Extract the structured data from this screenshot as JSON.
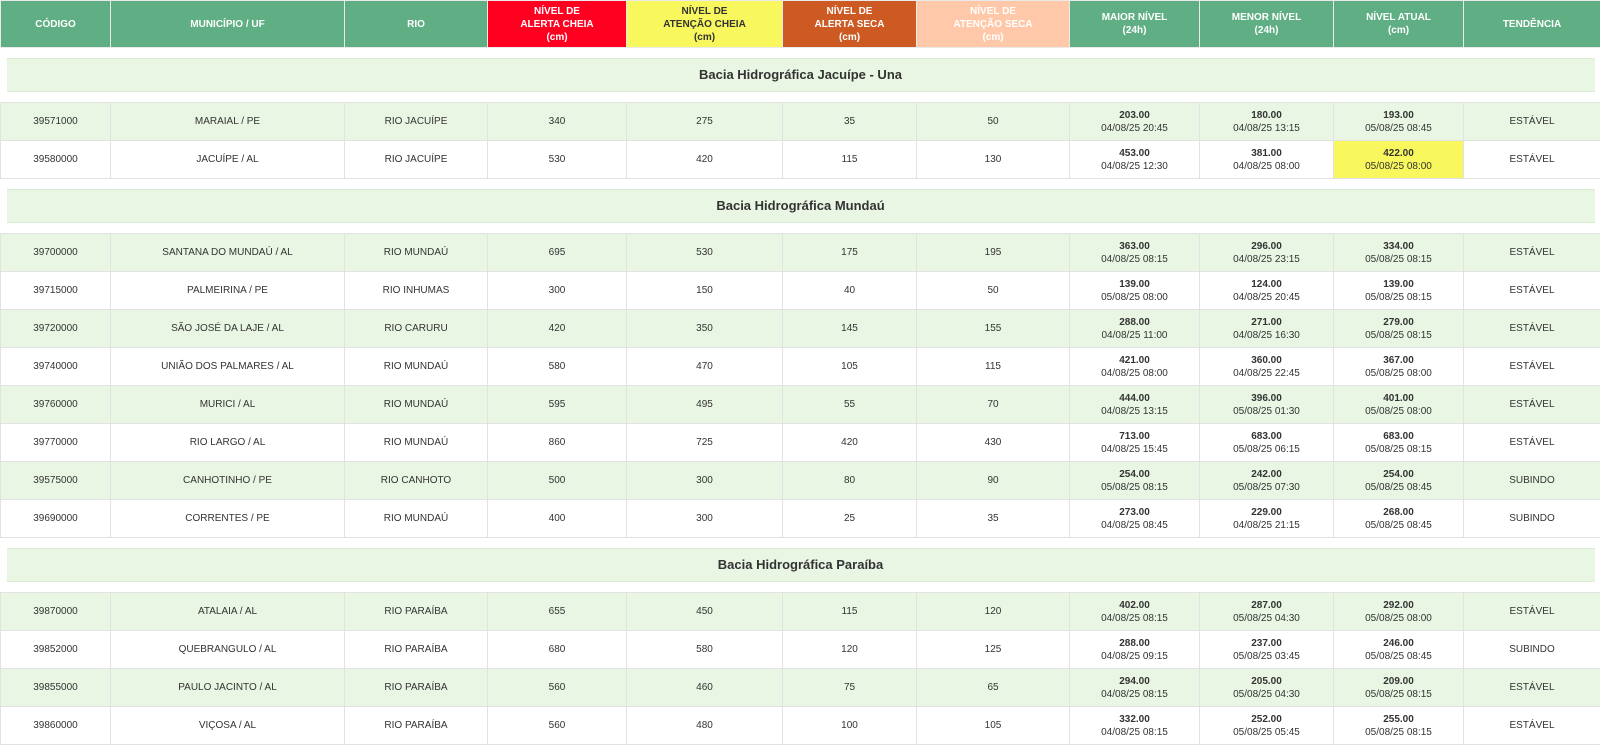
{
  "colors": {
    "header_green": "#5fae84",
    "alert_full": "#ff0020",
    "attention_full": "#f8f85e",
    "alert_dry": "#cc5a22",
    "attention_dry": "#ffc8a8",
    "row_alt": "#e8f6e3"
  },
  "headers": [
    {
      "l1": "CÓDIGO",
      "l2": "",
      "l3": ""
    },
    {
      "l1": "MUNICÍPIO / UF",
      "l2": "",
      "l3": ""
    },
    {
      "l1": "RIO",
      "l2": "",
      "l3": ""
    },
    {
      "l1": "NÍVEL DE",
      "l2": "ALERTA CHEIA",
      "l3": "(cm)"
    },
    {
      "l1": "NÍVEL DE",
      "l2": "ATENÇÃO CHEIA",
      "l3": "(cm)"
    },
    {
      "l1": "NÍVEL DE",
      "l2": "ALERTA SECA",
      "l3": "(cm)"
    },
    {
      "l1": "NÍVEL DE",
      "l2": "ATENÇÃO SECA",
      "l3": "(cm)"
    },
    {
      "l1": "MAIOR NÍVEL",
      "l2": "(24h)",
      "l3": ""
    },
    {
      "l1": "MENOR NÍVEL",
      "l2": "(24h)",
      "l3": ""
    },
    {
      "l1": "NÍVEL ATUAL",
      "l2": "(cm)",
      "l3": ""
    },
    {
      "l1": "TENDÊNCIA",
      "l2": "",
      "l3": ""
    }
  ],
  "groups": [
    {
      "title": "Bacia Hidrográfica Jacuípe - Una",
      "rows": [
        {
          "codigo": "39571000",
          "municipio": "MARAIAL / PE",
          "rio": "RIO JACUÍPE",
          "alerta_cheia": "340",
          "atencao_cheia": "275",
          "alerta_seca": "35",
          "atencao_seca": "50",
          "maior_v": "203.00",
          "maior_d": "04/08/25 20:45",
          "menor_v": "180.00",
          "menor_d": "04/08/25 13:15",
          "atual_v": "193.00",
          "atual_d": "05/08/25 08:45",
          "tendencia": "ESTÁVEL"
        },
        {
          "codigo": "39580000",
          "municipio": "JACUÍPE / AL",
          "rio": "RIO JACUÍPE",
          "alerta_cheia": "530",
          "atencao_cheia": "420",
          "alerta_seca": "115",
          "atencao_seca": "130",
          "maior_v": "453.00",
          "maior_d": "04/08/25 12:30",
          "menor_v": "381.00",
          "menor_d": "04/08/25 08:00",
          "atual_v": "422.00",
          "atual_d": "05/08/25 08:00",
          "tendencia": "ESTÁVEL"
        }
      ]
    },
    {
      "title": "Bacia Hidrográfica Mundaú",
      "rows": [
        {
          "codigo": "39700000",
          "municipio": "SANTANA DO MUNDAÚ / AL",
          "rio": "RIO MUNDAÚ",
          "alerta_cheia": "695",
          "atencao_cheia": "530",
          "alerta_seca": "175",
          "atencao_seca": "195",
          "maior_v": "363.00",
          "maior_d": "04/08/25 08:15",
          "menor_v": "296.00",
          "menor_d": "04/08/25 23:15",
          "atual_v": "334.00",
          "atual_d": "05/08/25 08:15",
          "tendencia": "ESTÁVEL"
        },
        {
          "codigo": "39715000",
          "municipio": "PALMEIRINA / PE",
          "rio": "RIO INHUMAS",
          "alerta_cheia": "300",
          "atencao_cheia": "150",
          "alerta_seca": "40",
          "atencao_seca": "50",
          "maior_v": "139.00",
          "maior_d": "05/08/25 08:00",
          "menor_v": "124.00",
          "menor_d": "04/08/25 20:45",
          "atual_v": "139.00",
          "atual_d": "05/08/25 08:15",
          "tendencia": "ESTÁVEL"
        },
        {
          "codigo": "39720000",
          "municipio": "SÃO JOSÉ DA LAJE / AL",
          "rio": "RIO CARURU",
          "alerta_cheia": "420",
          "atencao_cheia": "350",
          "alerta_seca": "145",
          "atencao_seca": "155",
          "maior_v": "288.00",
          "maior_d": "04/08/25 11:00",
          "menor_v": "271.00",
          "menor_d": "04/08/25 16:30",
          "atual_v": "279.00",
          "atual_d": "05/08/25 08:15",
          "tendencia": "ESTÁVEL"
        },
        {
          "codigo": "39740000",
          "municipio": "UNIÃO DOS PALMARES / AL",
          "rio": "RIO MUNDAÚ",
          "alerta_cheia": "580",
          "atencao_cheia": "470",
          "alerta_seca": "105",
          "atencao_seca": "115",
          "maior_v": "421.00",
          "maior_d": "04/08/25 08:00",
          "menor_v": "360.00",
          "menor_d": "04/08/25 22:45",
          "atual_v": "367.00",
          "atual_d": "05/08/25 08:00",
          "tendencia": "ESTÁVEL"
        },
        {
          "codigo": "39760000",
          "municipio": "MURICI / AL",
          "rio": "RIO MUNDAÚ",
          "alerta_cheia": "595",
          "atencao_cheia": "495",
          "alerta_seca": "55",
          "atencao_seca": "70",
          "maior_v": "444.00",
          "maior_d": "04/08/25 13:15",
          "menor_v": "396.00",
          "menor_d": "05/08/25 01:30",
          "atual_v": "401.00",
          "atual_d": "05/08/25 08:00",
          "tendencia": "ESTÁVEL"
        },
        {
          "codigo": "39770000",
          "municipio": "RIO LARGO / AL",
          "rio": "RIO MUNDAÚ",
          "alerta_cheia": "860",
          "atencao_cheia": "725",
          "alerta_seca": "420",
          "atencao_seca": "430",
          "maior_v": "713.00",
          "maior_d": "04/08/25 15:45",
          "menor_v": "683.00",
          "menor_d": "05/08/25 06:15",
          "atual_v": "683.00",
          "atual_d": "05/08/25 08:15",
          "tendencia": "ESTÁVEL"
        },
        {
          "codigo": "39575000",
          "municipio": "CANHOTINHO / PE",
          "rio": "RIO CANHOTO",
          "alerta_cheia": "500",
          "atencao_cheia": "300",
          "alerta_seca": "80",
          "atencao_seca": "90",
          "maior_v": "254.00",
          "maior_d": "05/08/25 08:15",
          "menor_v": "242.00",
          "menor_d": "05/08/25 07:30",
          "atual_v": "254.00",
          "atual_d": "05/08/25 08:45",
          "tendencia": "SUBINDO"
        },
        {
          "codigo": "39690000",
          "municipio": "CORRENTES / PE",
          "rio": "RIO MUNDAÚ",
          "alerta_cheia": "400",
          "atencao_cheia": "300",
          "alerta_seca": "25",
          "atencao_seca": "35",
          "maior_v": "273.00",
          "maior_d": "04/08/25 08:45",
          "menor_v": "229.00",
          "menor_d": "04/08/25 21:15",
          "atual_v": "268.00",
          "atual_d": "05/08/25 08:45",
          "tendencia": "SUBINDO"
        }
      ]
    },
    {
      "title": "Bacia Hidrográfica Paraíba",
      "rows": [
        {
          "codigo": "39870000",
          "municipio": "ATALAIA / AL",
          "rio": "RIO PARAÍBA",
          "alerta_cheia": "655",
          "atencao_cheia": "450",
          "alerta_seca": "115",
          "atencao_seca": "120",
          "maior_v": "402.00",
          "maior_d": "04/08/25 08:15",
          "menor_v": "287.00",
          "menor_d": "05/08/25 04:30",
          "atual_v": "292.00",
          "atual_d": "05/08/25 08:00",
          "tendencia": "ESTÁVEL"
        },
        {
          "codigo": "39852000",
          "municipio": "QUEBRANGULO / AL",
          "rio": "RIO PARAÍBA",
          "alerta_cheia": "680",
          "atencao_cheia": "580",
          "alerta_seca": "120",
          "atencao_seca": "125",
          "maior_v": "288.00",
          "maior_d": "04/08/25 09:15",
          "menor_v": "237.00",
          "menor_d": "05/08/25 03:45",
          "atual_v": "246.00",
          "atual_d": "05/08/25 08:45",
          "tendencia": "SUBINDO"
        },
        {
          "codigo": "39855000",
          "municipio": "PAULO JACINTO / AL",
          "rio": "RIO PARAÍBA",
          "alerta_cheia": "560",
          "atencao_cheia": "460",
          "alerta_seca": "75",
          "atencao_seca": "65",
          "maior_v": "294.00",
          "maior_d": "04/08/25 08:15",
          "menor_v": "205.00",
          "menor_d": "05/08/25 04:30",
          "atual_v": "209.00",
          "atual_d": "05/08/25 08:15",
          "tendencia": "ESTÁVEL"
        },
        {
          "codigo": "39860000",
          "municipio": "VIÇOSA / AL",
          "rio": "RIO PARAÍBA",
          "alerta_cheia": "560",
          "atencao_cheia": "480",
          "alerta_seca": "100",
          "atencao_seca": "105",
          "maior_v": "332.00",
          "maior_d": "04/08/25 08:15",
          "menor_v": "252.00",
          "menor_d": "05/08/25 05:45",
          "atual_v": "255.00",
          "atual_d": "05/08/25 08:15",
          "tendencia": "ESTÁVEL"
        }
      ]
    }
  ]
}
